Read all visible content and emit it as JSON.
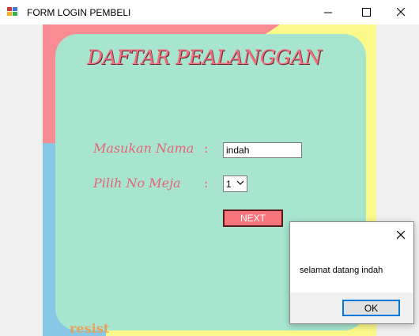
{
  "window": {
    "title": "FORM LOGIN PEMBELI",
    "icon": "winforms-app-icon",
    "controls": {
      "minimize": "minimize-icon",
      "maximize": "maximize-icon",
      "close": "close-icon"
    }
  },
  "form": {
    "heading": "DAFTAR PEALANGGAN",
    "name_label": "Masukan Nama",
    "table_label": "Pilih No Meja",
    "colon": ":",
    "name_value": "indah",
    "table_selected": "1",
    "next_label": "NEXT",
    "footer_text": "resist"
  },
  "dialog": {
    "message": "selamat datang indah",
    "ok_label": "OK"
  },
  "colors": {
    "panel": "#a7e5cf",
    "pink": "#f98b93",
    "yellow": "#fbf98a",
    "blue": "#86c8e6",
    "next_button": "#f9747b",
    "label_text": "#e66574"
  }
}
